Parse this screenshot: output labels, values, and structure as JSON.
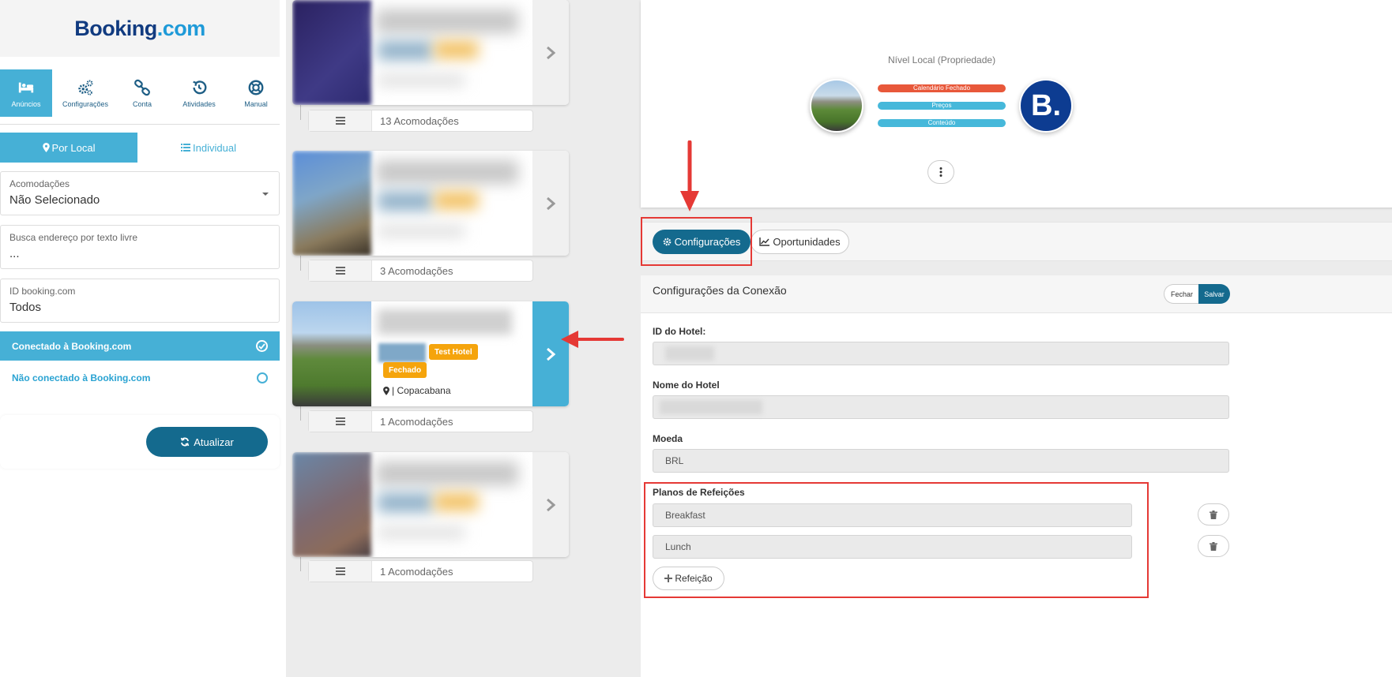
{
  "brand": {
    "part1": "Booking",
    "part2": ".com"
  },
  "nav": [
    {
      "label": "Anúncios",
      "icon": "bed-icon"
    },
    {
      "label": "Configurações",
      "icon": "gears-icon"
    },
    {
      "label": "Conta",
      "icon": "link-icon"
    },
    {
      "label": "Atividades",
      "icon": "history-icon"
    },
    {
      "label": "Manual",
      "icon": "lifebuoy-icon"
    }
  ],
  "view_toggle": {
    "by_location": "Por Local",
    "individual": "Individual"
  },
  "filters": {
    "accommodations": {
      "label": "Acomodações",
      "value": "Não Selecionado"
    },
    "address_search": {
      "label": "Busca endereço por texto livre",
      "value": "..."
    },
    "booking_id": {
      "label": "ID booking.com",
      "value": "Todos"
    }
  },
  "connection_filter": {
    "connected": "Conectado à Booking.com",
    "not_connected": "Não conectado à Booking.com"
  },
  "update_button": "Atualizar",
  "listings": [
    {
      "count": "13 Acomodações"
    },
    {
      "count": "3 Acomodações"
    },
    {
      "count": "1 Acomodações",
      "badge_test": "Test Hotel",
      "badge_status": "Fechado",
      "location": "| Copacabana"
    },
    {
      "count": "1 Acomodações"
    }
  ],
  "property_level": {
    "title": "Nível Local (Propriedade)",
    "statuses": [
      {
        "label": "Calendário Fechado",
        "color": "#e8583a"
      },
      {
        "label": "Preços",
        "color": "#46b8da"
      },
      {
        "label": "Conteúdo",
        "color": "#46b8da"
      }
    ],
    "channel_logo": "B."
  },
  "tabs": {
    "settings": "Configurações",
    "opportunities": "Oportunidades"
  },
  "connection_settings": {
    "title": "Configurações da Conexão",
    "close": "Fechar",
    "save": "Salvar",
    "hotel_id_label": "ID do Hotel:",
    "hotel_name_label": "Nome do Hotel",
    "currency_label": "Moeda",
    "currency_value": "BRL",
    "meal_plans_label": "Planos de Refeições",
    "meal_plans": [
      "Breakfast",
      "Lunch"
    ],
    "add_meal": "Refeição"
  },
  "colors": {
    "accent": "#46b0d6",
    "primary_dark": "#146a8e",
    "badge": "#f5a40c",
    "annotation": "#e53935"
  }
}
